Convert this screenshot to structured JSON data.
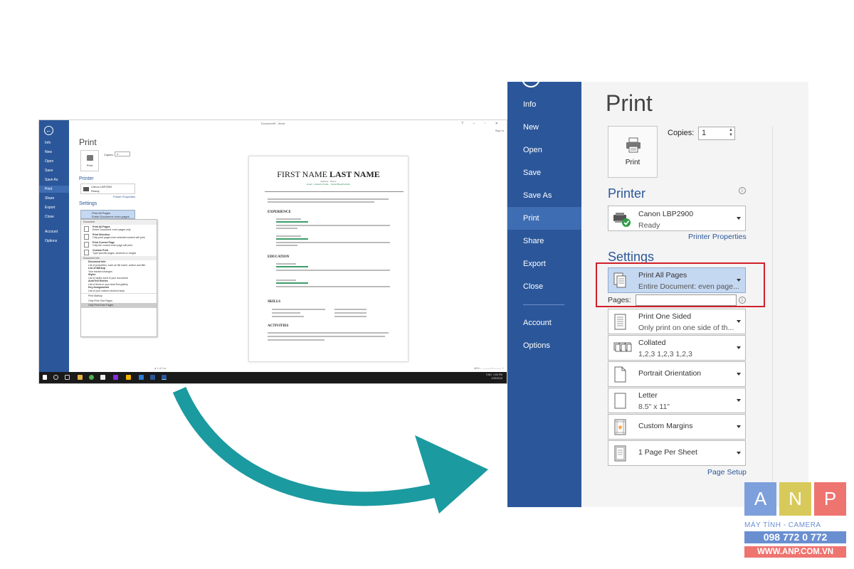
{
  "small_screenshot": {
    "window_title": "Document9 - Word",
    "window_controls": "? – ▫ ✕",
    "signin": "Sign in",
    "nav": [
      "Info",
      "New",
      "Open",
      "Save",
      "Save As",
      "Print",
      "Share",
      "Export",
      "Close",
      "Account",
      "Options"
    ],
    "print_heading": "Print",
    "print_button": "Print",
    "copies_label": "Copies:",
    "copies_value": "1",
    "printer_heading": "Printer",
    "printer_name": "Canon LBP2900",
    "printer_status": "Ready",
    "printer_properties": "Printer Properties",
    "settings_heading": "Settings",
    "selected_setting": "Print All Pages",
    "selected_setting_sub": "Entire Document: even pages",
    "dropdown": {
      "document_header": "Document",
      "items": [
        {
          "title": "Print All Pages",
          "desc": "Entire Document: even pages only"
        },
        {
          "title": "Print Selection",
          "desc": "Only print pages from selected content will print"
        },
        {
          "title": "Print Current Page",
          "desc": "Only the current even page will print"
        },
        {
          "title": "Custom Print",
          "desc": "Type specific pages, sections or ranges"
        }
      ],
      "info_header": "Document Info",
      "info_items": [
        {
          "title": "Document Info",
          "desc": "List of properties, such as file name, author and title"
        },
        {
          "title": "List of Markup",
          "desc": "Your tracked changes"
        },
        {
          "title": "Styles",
          "desc": "List of styles used in your document"
        },
        {
          "title": "AutoText Entries",
          "desc": "List of items in your AutoText gallery"
        },
        {
          "title": "Key Assignments",
          "desc": "List of your custom shortcut keys"
        }
      ],
      "toggles": [
        "Print Markup",
        "Only Print Odd Pages",
        "Only Print Even Pages"
      ]
    },
    "resume": {
      "first_name": "FIRST NAME ",
      "last_name": "LAST NAME",
      "address": "Address · Phone",
      "links": "Email · LinkedIn Profile · Twitter/Blog/Portfolio",
      "sections": [
        "EXPERIENCE",
        "EDUCATION",
        "SKILLS",
        "ACTIVITIES"
      ]
    },
    "page_nav": "◂  1  of 1  ▸",
    "zoom": "46%  –  ———+———  +",
    "tray_time": "1:53 PM",
    "tray_date": "1/20/2019",
    "tray_lang": "ENG"
  },
  "big_panel": {
    "nav": [
      "Info",
      "New",
      "Open",
      "Save",
      "Save As",
      "Print",
      "Share",
      "Export",
      "Close",
      "Account",
      "Options"
    ],
    "print_heading": "Print",
    "print_button": "Print",
    "copies_label": "Copies:",
    "copies_value": "1",
    "printer_heading": "Printer",
    "printer_name": "Canon LBP2900",
    "printer_status": "Ready",
    "printer_properties": "Printer Properties",
    "settings_heading": "Settings",
    "settings": [
      {
        "line1": "Print All Pages",
        "line2": "Entire Document: even page..."
      },
      {
        "line1": "Print One Sided",
        "line2": "Only print on one side of th..."
      },
      {
        "line1": "Collated",
        "line2": "1,2,3    1,2,3    1,2,3"
      },
      {
        "line1": "Portrait Orientation",
        "line2": ""
      },
      {
        "line1": "Letter",
        "line2": "8.5\" x 11\""
      },
      {
        "line1": "Custom Margins",
        "line2": ""
      },
      {
        "line1": "1 Page Per Sheet",
        "line2": ""
      }
    ],
    "pages_label": "Pages:",
    "pages_value": "",
    "page_setup": "Page Setup",
    "info_glyph": "i"
  },
  "logo": {
    "letters": [
      "A",
      "N",
      "P"
    ],
    "tagline": "MÁY TÍNH - CAMERA",
    "phone": "098 772 0 772",
    "website": "WWW.ANP.COM.VN",
    "colors": {
      "box_a": "#7da0dc",
      "box_n": "#d8ca5a",
      "box_p": "#ee7470",
      "blue": "#6a8fd0",
      "red": "#ee7470"
    }
  },
  "colors": {
    "word_blue": "#2b579a",
    "arrow_teal": "#1b9aa0",
    "highlight_red": "#d0202a"
  }
}
